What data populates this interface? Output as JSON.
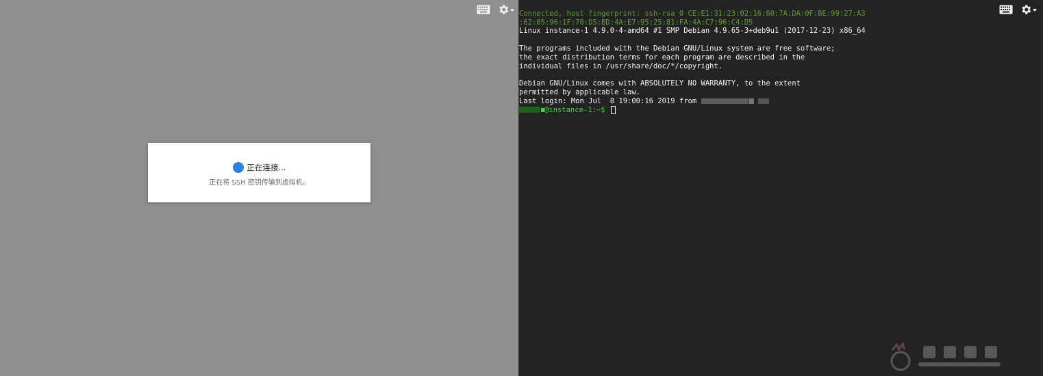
{
  "left_pane": {
    "toolbar": {
      "keyboard_icon": "keyboard-icon",
      "settings_icon": "gear-icon"
    },
    "dialog": {
      "title": "正在连接...",
      "subtitle": "正在将 SSH 密钥传输到虚拟机。"
    }
  },
  "right_pane": {
    "toolbar": {
      "keyboard_icon": "keyboard-icon",
      "settings_icon": "gear-icon"
    },
    "terminal": {
      "fingerprint_line1": "Connected, host fingerprint: ssh-rsa 0 CE:E1:31:23:02:16:60:7A:DA:0F:BE:99:27:A3",
      "fingerprint_line2": ":62:05:96:1F:70:D5:BD:4A:E7:95:25:81:FA:4A:C7:96:C4:D5",
      "kernel_line": "Linux instance-1 4.9.0-4-amd64 #1 SMP Debian 4.9.65-3+deb9u1 (2017-12-23) x86_64",
      "motd_line1": "The programs included with the Debian GNU/Linux system are free software;",
      "motd_line2": "the exact distribution terms for each program are described in the",
      "motd_line3": "individual files in /usr/share/doc/*/copyright.",
      "warranty_line1": "Debian GNU/Linux comes with ABSOLUTELY NO WARRANTY, to the extent",
      "warranty_line2": "permitted by applicable law.",
      "last_login": "Last login: Mon Jul  8 19:00:16 2019 from ",
      "prompt_host": "@instance-1:~$ "
    }
  },
  "colors": {
    "left_background": "#8f8f8f",
    "terminal_background": "#232323",
    "fingerprint_green": "#5aa02c",
    "prompt_green": "#4fd14f",
    "spinner_blue": "#2f7fdc"
  }
}
